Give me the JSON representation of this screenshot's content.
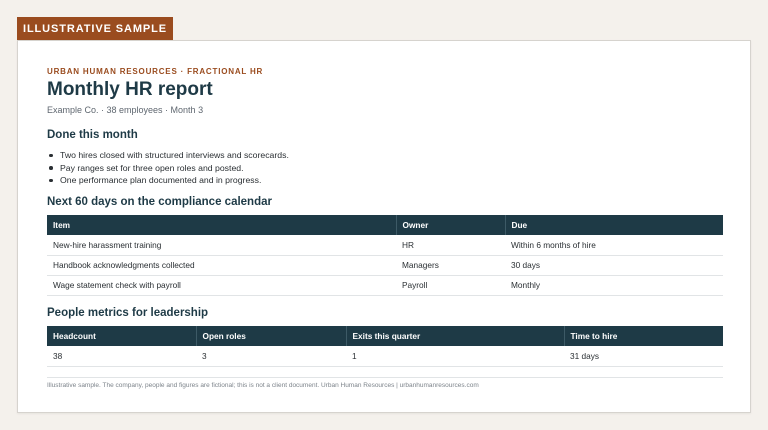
{
  "badge": "ILLUSTRATIVE SAMPLE",
  "report": {
    "eyebrow": "URBAN HUMAN RESOURCES · FRACTIONAL HR",
    "title": "Monthly HR report",
    "subtitle": "Example Co. · 38 employees · Month 3"
  },
  "done": {
    "heading": "Done this month",
    "items": [
      "Two hires closed with structured interviews and scorecards.",
      "Pay ranges set for three open roles and posted.",
      "One performance plan documented and in progress."
    ]
  },
  "compliance": {
    "heading": "Next 60 days on the compliance calendar",
    "columns": [
      "Item",
      "Owner",
      "Due"
    ],
    "rows": [
      [
        "New-hire harassment training",
        "HR",
        "Within 6 months of hire"
      ],
      [
        "Handbook acknowledgments collected",
        "Managers",
        "30 days"
      ],
      [
        "Wage statement check with payroll",
        "Payroll",
        "Monthly"
      ]
    ]
  },
  "metrics": {
    "heading": "People metrics for leadership",
    "columns": [
      "Headcount",
      "Open roles",
      "Exits this quarter",
      "Time to hire"
    ],
    "values": [
      "38",
      "3",
      "1",
      "31 days"
    ]
  },
  "footer": "Illustrative sample. The company, people and figures are fictional; this is not a client document. Urban Human Resources | urbanhumanresources.com",
  "colors": {
    "accent": "#9a4c1f",
    "header_bg": "#1e3a46",
    "page_bg": "#f4f1ec"
  }
}
